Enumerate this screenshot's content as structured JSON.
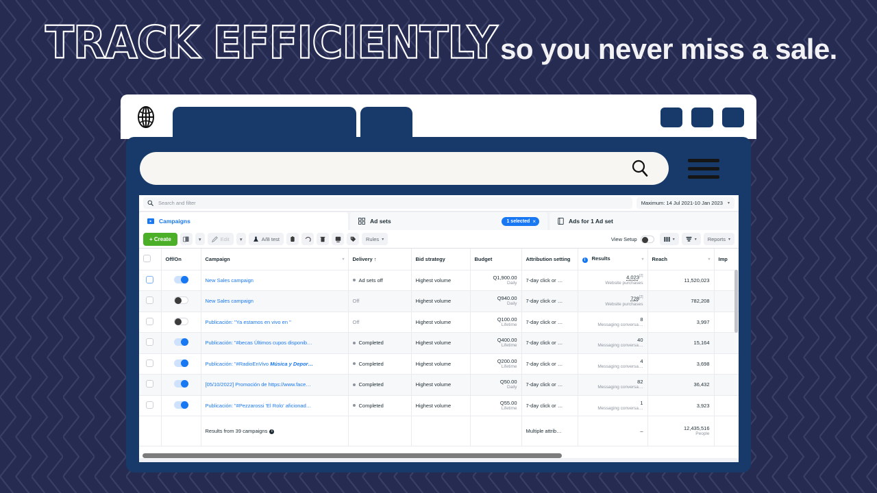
{
  "headline": {
    "outline_text": "TRACK EFFICIENTLY",
    "solid_text": "so you never miss a sale.",
    "outline_color": "#ffffff",
    "solid_color": "#f2f2f5",
    "background_color": "#262b52"
  },
  "browser": {
    "globe_icon": "globe-icon",
    "tab1_label": "",
    "tab2_label": "",
    "window_buttons": [
      "",
      "",
      ""
    ],
    "search_placeholder": "",
    "search_icon": "search-icon",
    "menu_icon": "hamburger-menu-icon",
    "chrome_color": "#173a6a"
  },
  "app": {
    "filter": {
      "search_icon": "search-icon",
      "placeholder": "Search and filter",
      "date_range": "Maximum: 14 Jul 2021-10 Jan 2023",
      "date_caret": "▾"
    },
    "tabs": [
      {
        "label": "Campaigns",
        "icon": "campaigns-icon",
        "active": true
      },
      {
        "label": "Ad sets",
        "icon": "adsets-icon",
        "badge": "1 selected",
        "badge_close": "×",
        "active": false
      },
      {
        "label": "Ads for 1 Ad set",
        "icon": "ads-icon",
        "active": false
      }
    ],
    "toolbar": {
      "create_label": "+  Create",
      "duplicate_icon": "duplicate-icon",
      "duplicate_caret": "▾",
      "edit_label": "Edit",
      "edit_icon": "pencil-icon",
      "edit_caret": "▾",
      "abtest_label": "A/B test",
      "abtest_icon": "flask-icon",
      "copy_icon": "copy-icon",
      "revert_icon": "undo-icon",
      "delete_icon": "trash-icon",
      "export_icon": "export-icon",
      "tag_icon": "tag-icon",
      "rules_label": "Rules",
      "rules_caret": "▾",
      "view_setup_label": "View Setup",
      "view_setup_toggle": "off",
      "columns_icon": "columns-icon",
      "columns_caret": "▾",
      "breakdown_icon": "breakdown-icon",
      "breakdown_caret": "▾",
      "reports_label": "Reports",
      "reports_caret": "▾"
    },
    "table": {
      "columns": [
        {
          "key": "check",
          "label": ""
        },
        {
          "key": "offon",
          "label": "Off/On"
        },
        {
          "key": "campaign",
          "label": "Campaign",
          "caret": "▾"
        },
        {
          "key": "delivery",
          "label": "Delivery ↑",
          "sorted": true
        },
        {
          "key": "bid",
          "label": "Bid strategy"
        },
        {
          "key": "budget",
          "label": "Budget"
        },
        {
          "key": "attribution",
          "label": "Attribution setting"
        },
        {
          "key": "results",
          "label": "Results",
          "info": "i",
          "caret": "▾"
        },
        {
          "key": "reach",
          "label": "Reach",
          "caret": "▾"
        },
        {
          "key": "impressions",
          "label": "Imp"
        }
      ],
      "rows": [
        {
          "checked": false,
          "check_focus": true,
          "toggle": "on",
          "campaign": "New Sales campaign",
          "delivery": "Ad sets off",
          "delivery_muted": false,
          "delivery_dot": true,
          "bid": "Highest volume",
          "budget": "Q1,900.00",
          "budget_sub": "Daily",
          "attribution": "7-day click or …",
          "results": "4,023",
          "results_sup": "[2]",
          "results_sub": "Website purchases",
          "reach": "11,520,023"
        },
        {
          "checked": false,
          "check_focus": false,
          "toggle": "off",
          "campaign": "New Sales campaign",
          "delivery": "Off",
          "delivery_muted": true,
          "delivery_dot": false,
          "bid": "Highest volume",
          "budget": "Q940.00",
          "budget_sub": "Daily",
          "attribution": "7-day click or …",
          "results": "728",
          "results_sup": "[2]",
          "results_sub": "Website purchases",
          "reach": "782,208"
        },
        {
          "checked": false,
          "check_focus": false,
          "toggle": "off",
          "campaign": "Publicación: \"Ya estamos en vivo en \"",
          "delivery": "Off",
          "delivery_muted": true,
          "delivery_dot": false,
          "bid": "Highest volume",
          "budget": "Q100.00",
          "budget_sub": "Lifetime",
          "attribution": "7-day click or …",
          "results": "8",
          "results_sup": "",
          "results_sub": "Messaging conversa…",
          "reach": "3,997"
        },
        {
          "checked": false,
          "check_focus": false,
          "toggle": "on",
          "campaign": "Publicación: \"#becas Últimos cupos disponib…",
          "delivery": "Completed",
          "delivery_muted": false,
          "delivery_dot": true,
          "bid": "Highest volume",
          "budget": "Q400.00",
          "budget_sub": "Lifetime",
          "attribution": "7-day click or …",
          "results": "40",
          "results_sup": "",
          "results_sub": "Messaging conversa…",
          "reach": "15,164"
        },
        {
          "checked": false,
          "check_focus": false,
          "toggle": "on",
          "campaign": "Publicación: \"#RadioEnVivo ",
          "campaign_italic": "Música y Depor…",
          "delivery": "Completed",
          "delivery_muted": false,
          "delivery_dot": true,
          "bid": "Highest volume",
          "budget": "Q200.00",
          "budget_sub": "Lifetime",
          "attribution": "7-day click or …",
          "results": "4",
          "results_sup": "",
          "results_sub": "Messaging conversa…",
          "reach": "3,698"
        },
        {
          "checked": false,
          "check_focus": false,
          "toggle": "on",
          "campaign": "[05/10/2022] Promoción de https://www.face…",
          "delivery": "Completed",
          "delivery_muted": false,
          "delivery_dot": true,
          "bid": "Highest volume",
          "budget": "Q50.00",
          "budget_sub": "Daily",
          "attribution": "7-day click or …",
          "results": "82",
          "results_sup": "",
          "results_sub": "Messaging conversa…",
          "reach": "36,432"
        },
        {
          "checked": false,
          "check_focus": false,
          "toggle": "on",
          "campaign": "Publicación: \"#Pezzarossi 'El Rolo' aficionad…",
          "delivery": "Completed",
          "delivery_muted": false,
          "delivery_dot": true,
          "bid": "Highest volume",
          "budget": "Q55.00",
          "budget_sub": "Lifetime",
          "attribution": "7-day click or …",
          "results": "1",
          "results_sup": "",
          "results_sub": "Messaging conversa…",
          "reach": "3,923"
        }
      ],
      "footer": {
        "summary": "Results from 39 campaigns",
        "summary_info": "i",
        "attribution": "Multiple attrib…",
        "results": "–",
        "reach": "12,435,516",
        "reach_sub": "People"
      }
    }
  }
}
